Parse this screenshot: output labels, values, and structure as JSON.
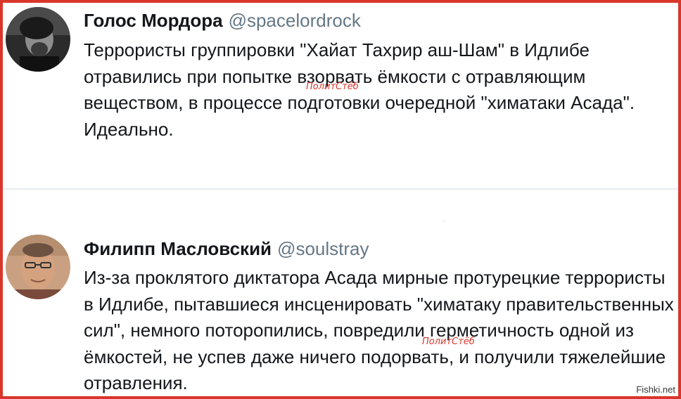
{
  "tweets": [
    {
      "name": "Голос Мордора",
      "handle": "@spacelordrock",
      "text": "Террористы группировки \"Хайат Тахрир аш-Шам\" в Идлибе отравились при попытке взорвать ёмкости с отравляющим веществом, в процессе подготовки очередной \"химатаки Асада\". Идеально."
    },
    {
      "name": "Филипп Масловский",
      "handle": "@soulstray",
      "text": "Из-за проклятого диктатора Асада мирные протурецкие террористы в Идлибе, пытавшиеся инсценировать \"химатаку правительственных сил\", немного поторопились, повредили герметичность одной из ёмкостей, не успев даже ничего подорвать, и получили тяжелейшие отравления."
    }
  ],
  "watermarks": [
    "ПолитСтёб",
    "ПолитСтёб"
  ],
  "corner_watermark": "Fishki.net",
  "colors": {
    "frame": "#d9362b",
    "name": "#14171a",
    "handle": "#657786",
    "watermark": "#d9362b",
    "divider": "#e6ecf0"
  }
}
